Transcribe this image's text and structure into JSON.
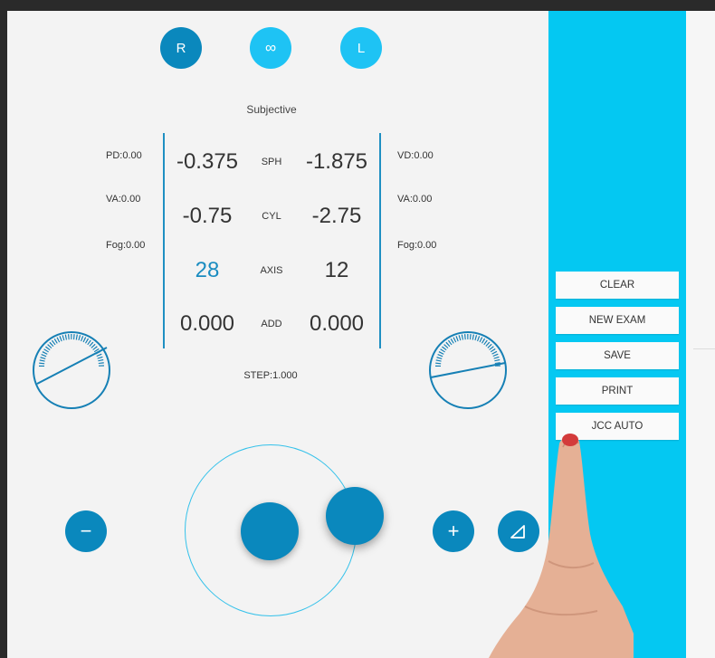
{
  "eye_selector": {
    "right": "R",
    "both": "∞",
    "left": "L"
  },
  "mode": "Subjective",
  "left_info": {
    "pd": "PD:0.00",
    "va": "VA:0.00",
    "fog": "Fog:0.00"
  },
  "right_info": {
    "vd": "VD:0.00",
    "va": "VA:0.00",
    "fog": "Fog:0.00"
  },
  "rows": [
    {
      "label": "SPH",
      "right": "-0.375",
      "left": "-1.875"
    },
    {
      "label": "CYL",
      "right": "-0.75",
      "left": "-2.75"
    },
    {
      "label": "AXIS",
      "right": "28",
      "left": "12"
    },
    {
      "label": "ADD",
      "right": "0.000",
      "left": "0.000"
    }
  ],
  "step": "STEP:1.000",
  "controls": {
    "minus": "−",
    "plus": "+"
  },
  "menu": {
    "clear": "CLEAR",
    "new_exam": "NEW EXAM",
    "save": "SAVE",
    "print": "PRINT",
    "jcc_auto": "JCC AUTO"
  },
  "colors": {
    "accent_dark": "#0a88bd",
    "accent_light": "#1ec3f4",
    "sidebar": "#04c8f2",
    "axis_highlight": "#1a8cc0"
  }
}
